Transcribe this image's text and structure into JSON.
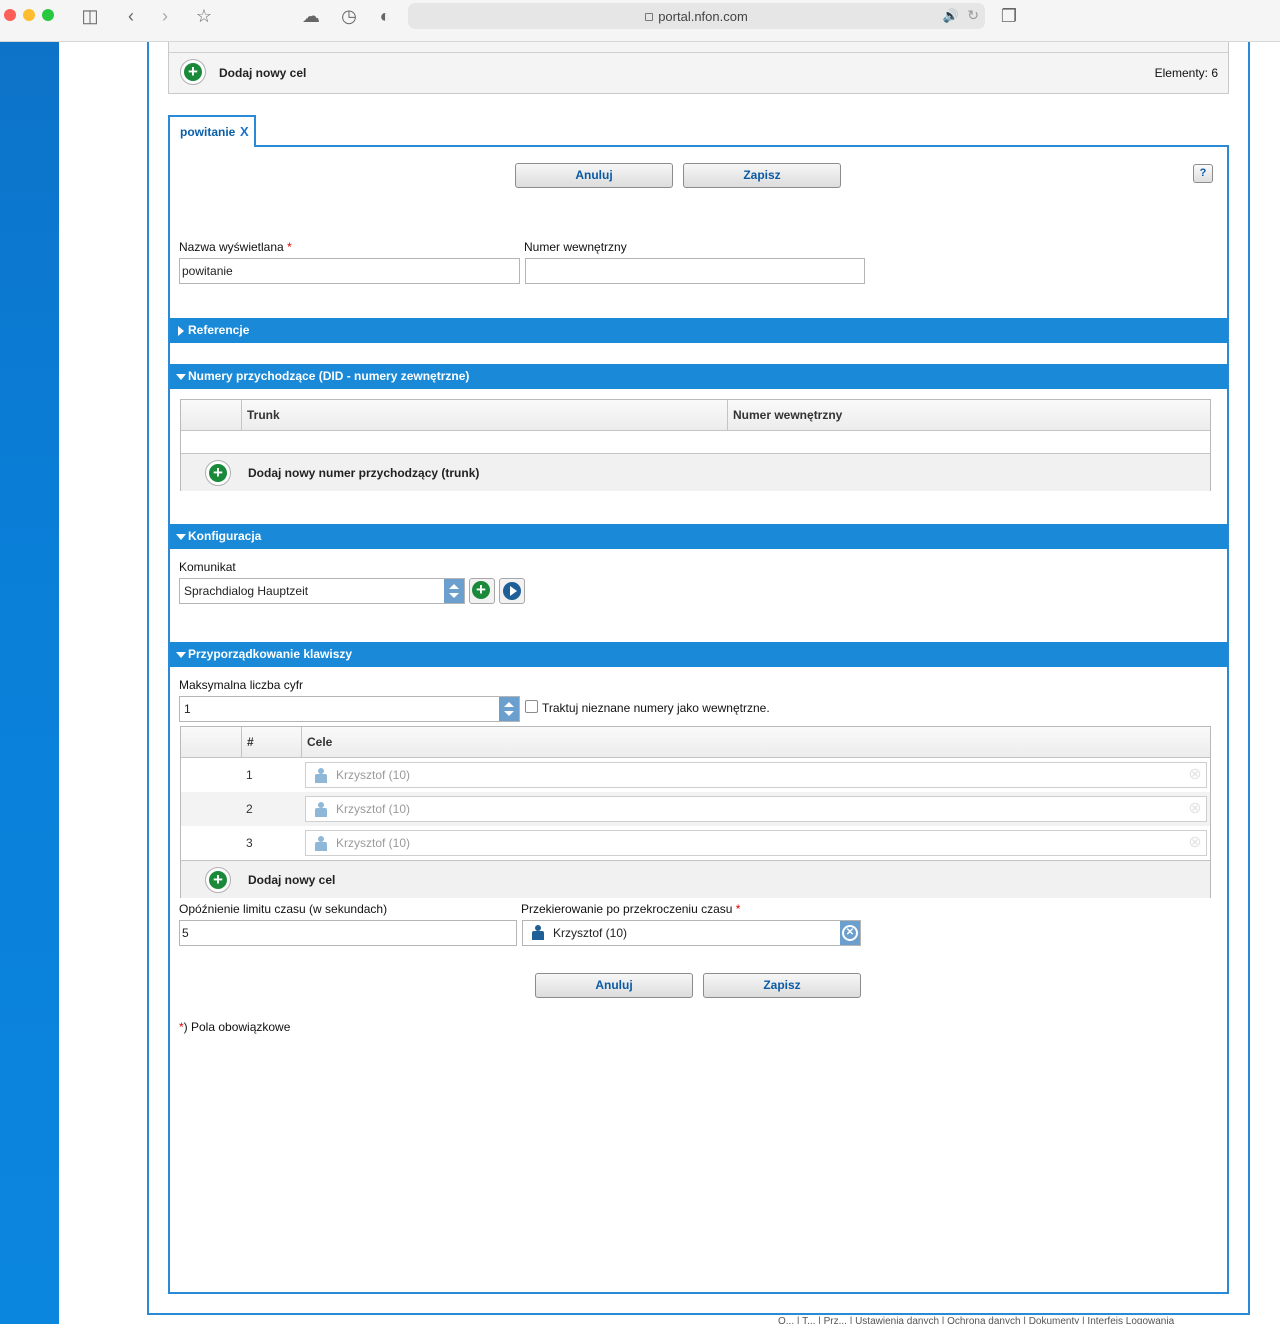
{
  "browser": {
    "url": "portal.nfon.com"
  },
  "top_panel": {
    "add_target_label": "Dodaj nowy cel",
    "elements_count": "Elementy: 6"
  },
  "tab": {
    "label": "powitanie",
    "close": "X"
  },
  "actions": {
    "cancel": "Anuluj",
    "save": "Zapisz",
    "help": "?"
  },
  "form": {
    "display_name_label": "Nazwa wyświetlana",
    "display_name_value": "powitanie",
    "internal_number_label": "Numer wewnętrzny",
    "internal_number_value": "",
    "required_mark": "*"
  },
  "sections": {
    "references": "Referencje",
    "did": "Numery przychodzące (DID - numery zewnętrzne)",
    "config": "Konfiguracja",
    "keys": "Przyporządkowanie klawiszy"
  },
  "did_table": {
    "columns": [
      "Trunk",
      "Numer wewnętrzny"
    ],
    "add_label": "Dodaj nowy numer przychodzący (trunk)"
  },
  "config": {
    "message_label": "Komunikat",
    "message_value": "Sprachdialog Hauptzeit"
  },
  "keys": {
    "max_digits_label": "Maksymalna liczba cyfr",
    "max_digits_value": "1",
    "unknown_internal_label": "Traktuj nieznane numery jako wewnętrzne.",
    "columns": [
      "#",
      "Cele"
    ],
    "rows": [
      {
        "num": "1",
        "target": "Krzysztof (10)"
      },
      {
        "num": "2",
        "target": "Krzysztof (10)"
      },
      {
        "num": "3",
        "target": "Krzysztof (10)"
      }
    ],
    "add_label": "Dodaj nowy cel",
    "timeout_label": "Opóźnienie limitu czasu (w sekundach)",
    "timeout_value": "5",
    "redirect_label": "Przekierowanie po przekroczeniu czasu",
    "redirect_value": "Krzysztof (10)"
  },
  "required_note": ") Pola obowiązkowe",
  "footer": "Q... | T... | Prz... | Ustawienia danych | Ochrona danych | Dokumenty | Interfejs Logowania"
}
